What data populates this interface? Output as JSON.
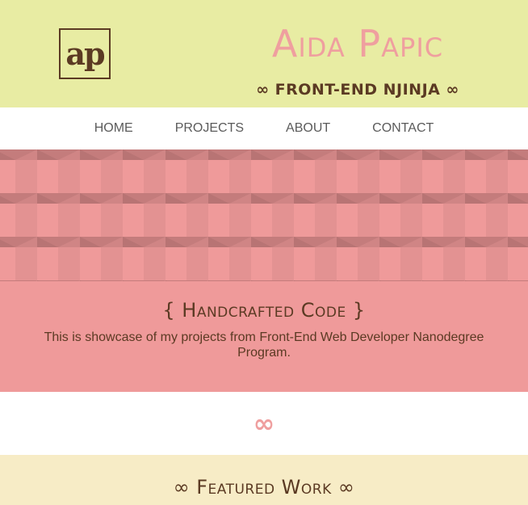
{
  "header": {
    "logo_text": "ap",
    "title": "Aida Papic",
    "subtitle": "∞ FRONT-END NJINJA ∞"
  },
  "nav": {
    "items": [
      {
        "label": "HOME"
      },
      {
        "label": "PROJECTS"
      },
      {
        "label": "ABOUT"
      },
      {
        "label": "CONTACT"
      }
    ]
  },
  "hero": {
    "title": "{ Handcrafted Code }",
    "text": "This is showcase of my projects from Front-End Web Developer Nanodegree Program."
  },
  "divider": {
    "symbol": "∞"
  },
  "featured": {
    "title": "∞ Featured Work ∞"
  },
  "colors": {
    "header_bg": "#e8eca3",
    "accent_pink": "#ef9f9f",
    "hero_bg": "#ef9a9a",
    "brown": "#5b3a23",
    "featured_bg": "#f7ecc6"
  }
}
